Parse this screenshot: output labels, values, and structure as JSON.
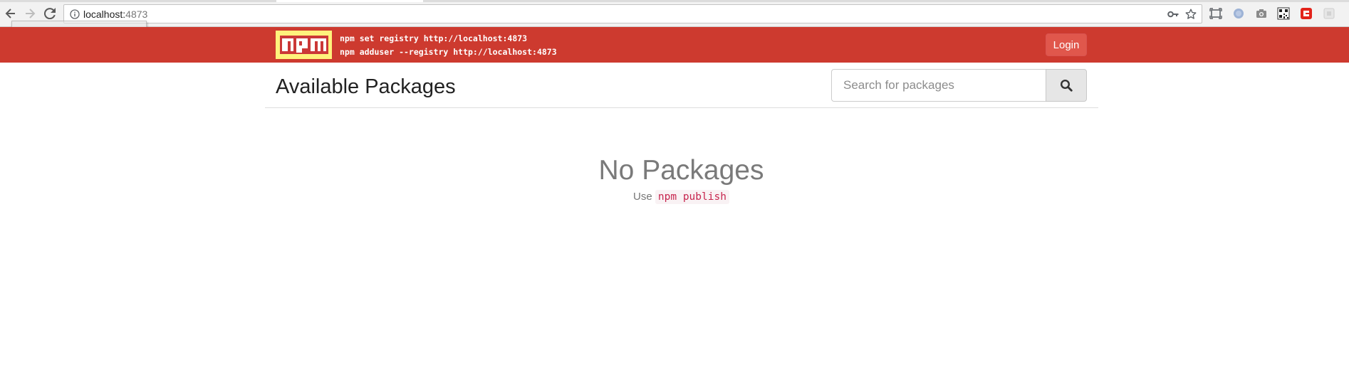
{
  "browser": {
    "url_host": "localhost:",
    "url_port": "4873"
  },
  "topbar": {
    "setup_line_1": "npm set registry http://localhost:4873",
    "setup_line_2": "npm adduser --registry http://localhost:4873",
    "login_label": "Login",
    "accent_color": "#cd3a2f",
    "logo_color": "#fff27c"
  },
  "header": {
    "title": "Available Packages",
    "search_placeholder": "Search for packages"
  },
  "empty_state": {
    "title": "No Packages",
    "hint_prefix": "Use",
    "hint_command": "npm publish"
  }
}
